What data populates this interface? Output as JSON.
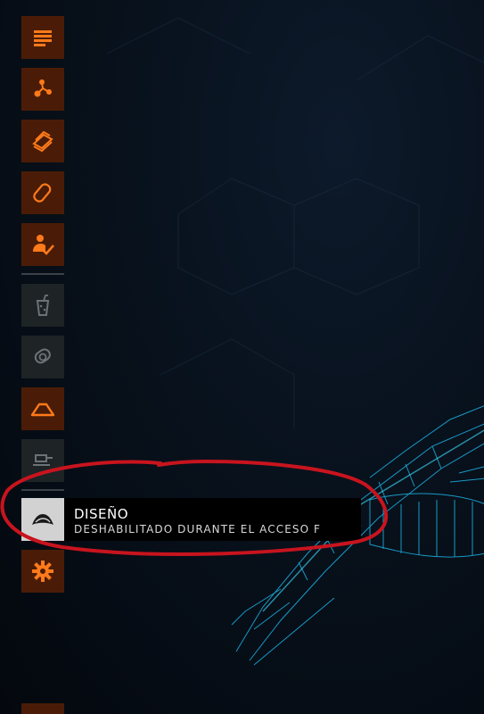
{
  "menu": {
    "items": [
      {
        "icon": "list-icon",
        "state": "active"
      },
      {
        "icon": "share-nodes-icon",
        "state": "active"
      },
      {
        "icon": "credits-stack-icon",
        "state": "active"
      },
      {
        "icon": "capsule-icon",
        "state": "active"
      },
      {
        "icon": "person-check-icon",
        "state": "active"
      },
      {
        "icon": "drink-cup-icon",
        "state": "disabled"
      },
      {
        "icon": "capsule-target-icon",
        "state": "disabled"
      },
      {
        "icon": "ship-hull-icon",
        "state": "active"
      },
      {
        "icon": "console-icon",
        "state": "disabled"
      },
      {
        "icon": "paintjob-icon",
        "state": "selected"
      },
      {
        "icon": "gear-icon",
        "state": "active"
      }
    ]
  },
  "tooltip": {
    "title": "DISEÑO",
    "subtitle": "DESHABILITADO DURANTE EL ACCESO F"
  },
  "colors": {
    "accent": "#ff7a1a",
    "tile_active": "#4a1c07",
    "tile_disabled": "#1e2326",
    "tile_selected": "#d2d2d2",
    "highlight_annotation": "#c8141e",
    "ship_wireframe": "#1ec8ff"
  }
}
